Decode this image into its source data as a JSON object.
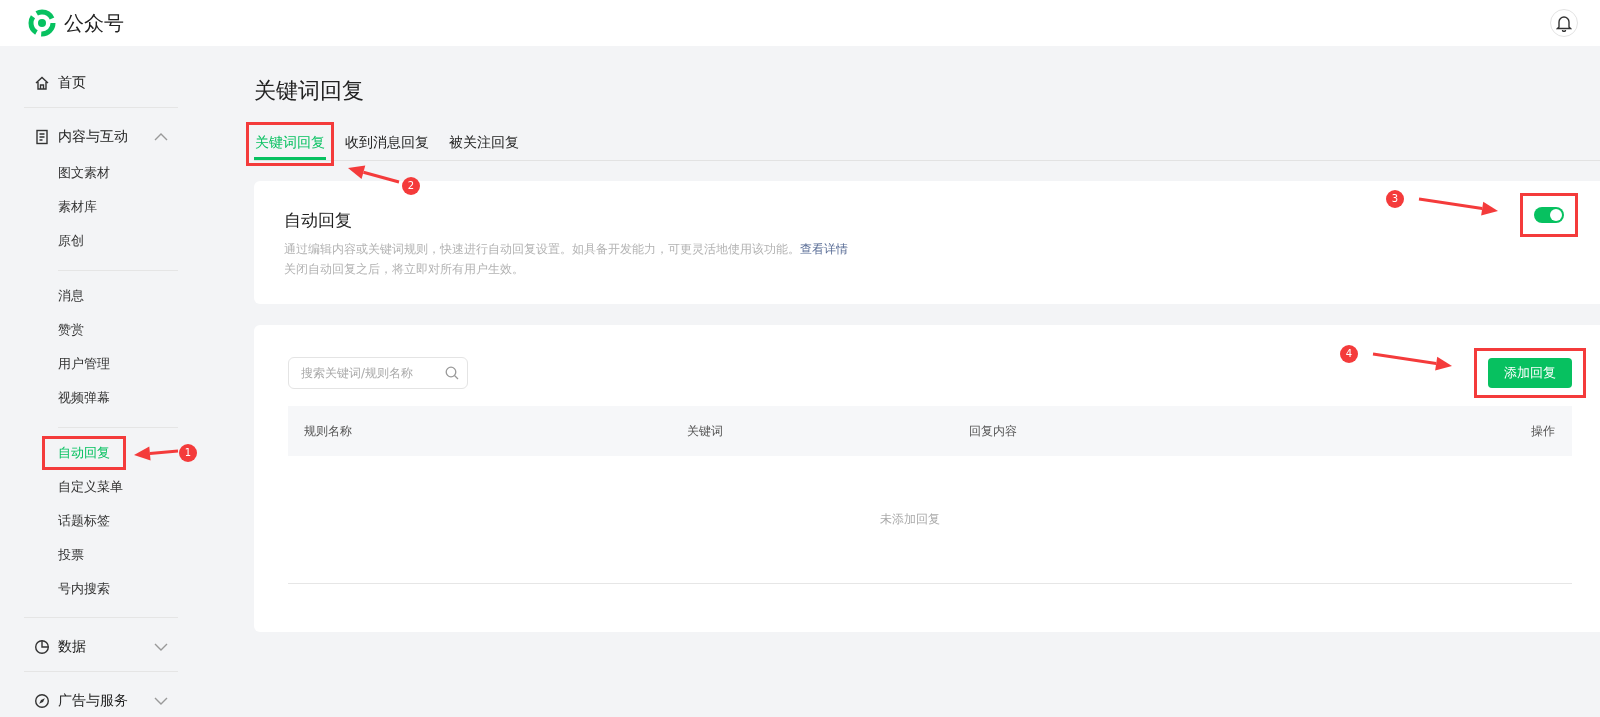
{
  "header": {
    "title": "公众号"
  },
  "sidebar": [
    {
      "label": "首页"
    },
    {
      "label": "内容与互动",
      "expanded": true,
      "groups": [
        [
          {
            "label": "图文素材",
            "selected": false
          },
          {
            "label": "素材库",
            "selected": false
          },
          {
            "label": "原创",
            "selected": false
          }
        ],
        [
          {
            "label": "消息",
            "selected": false
          },
          {
            "label": "赞赏",
            "selected": false
          },
          {
            "label": "用户管理",
            "selected": false
          },
          {
            "label": "视频弹幕",
            "selected": false
          }
        ],
        [
          {
            "label": "自动回复",
            "selected": true,
            "callout": "1"
          },
          {
            "label": "自定义菜单",
            "selected": false
          },
          {
            "label": "话题标签",
            "selected": false
          },
          {
            "label": "投票",
            "selected": false
          },
          {
            "label": "号内搜索",
            "selected": false
          }
        ]
      ]
    },
    {
      "label": "数据",
      "expanded": false
    },
    {
      "label": "广告与服务",
      "expanded": false
    }
  ],
  "page": {
    "title": "关键词回复",
    "tabs": [
      {
        "label": "关键词回复",
        "selected": true,
        "callout": "2"
      },
      {
        "label": "收到消息回复",
        "selected": false
      },
      {
        "label": "被关注回复",
        "selected": false
      }
    ],
    "auto_reply": {
      "title": "自动回复",
      "description": "通过编辑内容或关键词规则，快速进行自动回复设置。如具备开发能力，可更灵活地使用该功能。",
      "link": "查看详情",
      "note": "关闭自动回复之后，将立即对所有用户生效。",
      "on": true,
      "callout": "3"
    },
    "search": {
      "placeholder": "搜索关键词/规则名称"
    },
    "add_button": {
      "label": "添加回复",
      "callout": "4"
    },
    "table": {
      "columns": [
        "规则名称",
        "关键词",
        "回复内容",
        "操作"
      ],
      "empty": "未添加回复"
    }
  }
}
